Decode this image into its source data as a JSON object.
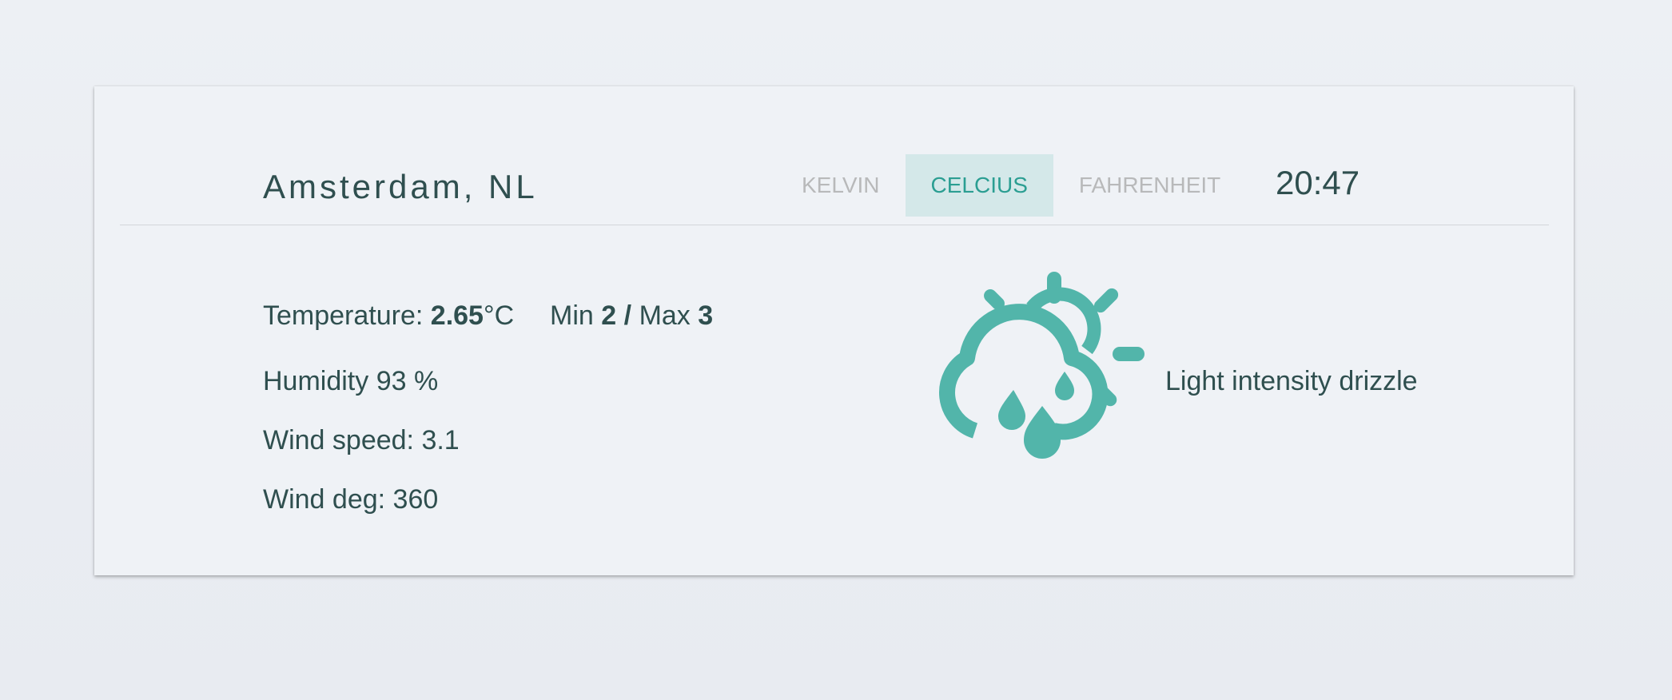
{
  "location": {
    "city": "Amsterdam, NL"
  },
  "units": {
    "tabs": [
      {
        "label": "KELVIN",
        "active": false
      },
      {
        "label": "CELCIUS",
        "active": true
      },
      {
        "label": "FAHRENHEIT",
        "active": false
      }
    ]
  },
  "clock": {
    "time": "20:47"
  },
  "weather": {
    "temperature_label": "Temperature:",
    "temperature_value": "2.65",
    "temperature_unit": "°C",
    "min_label": "Min",
    "min_value": "2",
    "separator": "/",
    "max_label": "Max",
    "max_value": "3",
    "humidity": "Humidity 93 %",
    "wind_speed": "Wind speed: 3.1",
    "wind_deg": "Wind deg: 360",
    "description": "Light intensity drizzle",
    "icon": "cloud-sun-drizzle-icon"
  },
  "colors": {
    "accent": "#52b5aa",
    "accent_text": "#2b9e92",
    "active_tab_bg": "#d4e8e9",
    "text": "#2f4f4f",
    "inactive_tab": "#b8b9ba"
  }
}
